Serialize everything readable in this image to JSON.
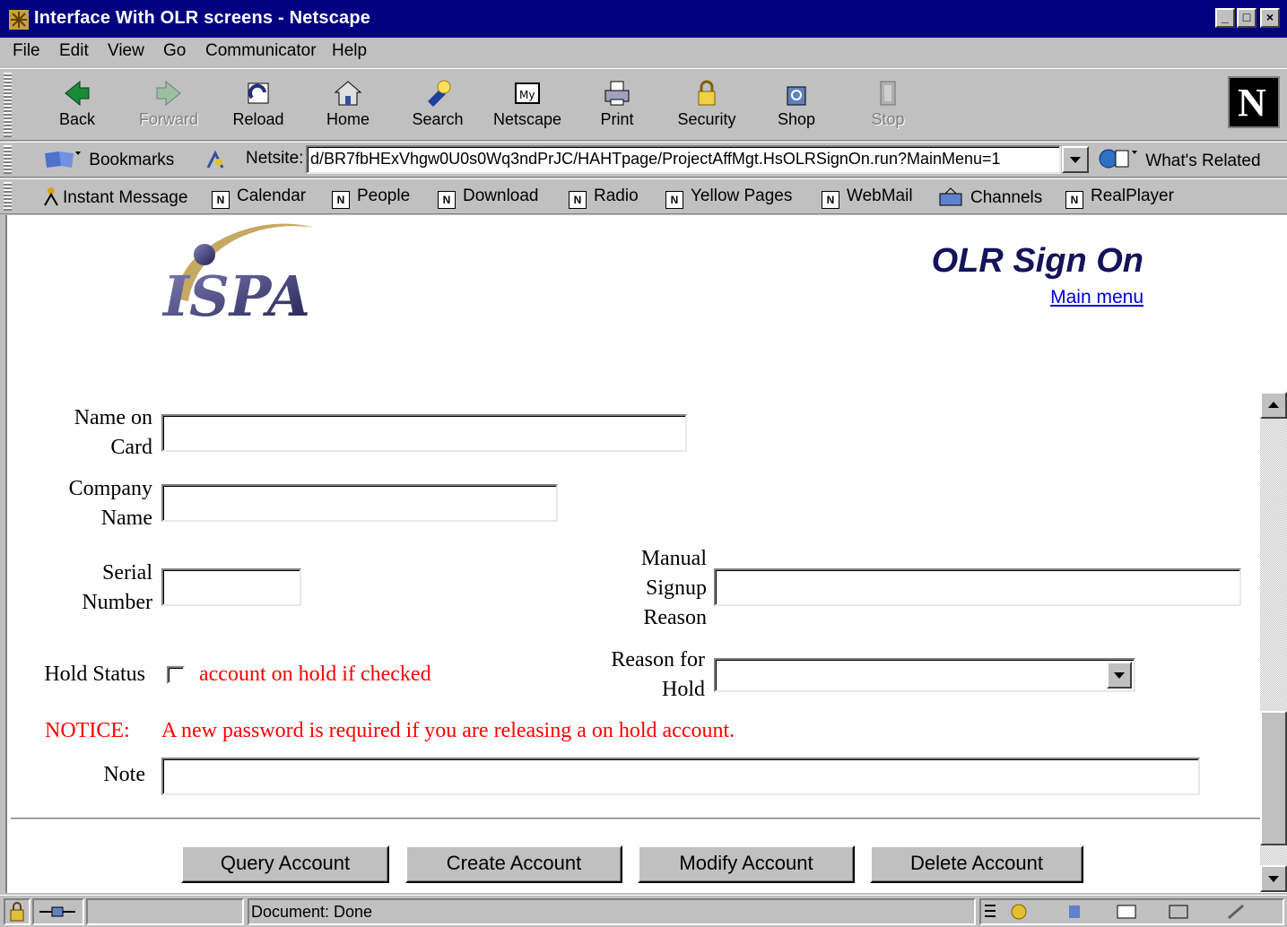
{
  "window": {
    "title": "Interface With OLR screens - Netscape",
    "minimize": "_",
    "maximize": "□",
    "close": "×"
  },
  "menu": [
    "File",
    "Edit",
    "View",
    "Go",
    "Communicator",
    "Help"
  ],
  "toolbar": {
    "back": "Back",
    "forward": "Forward",
    "reload": "Reload",
    "home": "Home",
    "search": "Search",
    "netscape": "Netscape",
    "print": "Print",
    "security": "Security",
    "shop": "Shop",
    "stop": "Stop",
    "logo": "N"
  },
  "location": {
    "bookmarks": "Bookmarks",
    "label": "Netsite:",
    "url": "d/BR7fbHExVhgw0U0s0Wq3ndPrJC/HAHTpage/ProjectAffMgt.HsOLRSignOn.run?MainMenu=1",
    "related": "What's Related"
  },
  "personal": [
    "Instant Message",
    "Calendar",
    "People",
    "Download",
    "Radio",
    "Yellow Pages",
    "WebMail",
    "Channels",
    "RealPlayer"
  ],
  "page": {
    "logo_text": "ISPA",
    "title": "OLR Sign On",
    "main_menu": "Main menu",
    "labels": {
      "name_on_card_1": "Name on",
      "name_on_card_2": "Card",
      "company_1": "Company",
      "company_2": "Name",
      "serial_1": "Serial",
      "serial_2": "Number",
      "manual_1": "Manual",
      "manual_2": "Signup",
      "manual_3": "Reason",
      "hold_status": "Hold Status",
      "hold_hint": "account on hold if checked",
      "reason_hold_1": "Reason for",
      "reason_hold_2": "Hold",
      "notice_label": "NOTICE:",
      "notice_text": "A new password is required if you are releasing a on hold account.",
      "note": "Note"
    },
    "fields": {
      "name_on_card": "",
      "company_name": "",
      "serial_number": "",
      "manual_signup_reason": "",
      "reason_for_hold": "",
      "note": "",
      "hold_checked": false
    },
    "buttons": {
      "query": "Query Account",
      "create": "Create Account",
      "modify": "Modify Account",
      "delete": "Delete Account"
    }
  },
  "status": {
    "text": "Document: Done"
  },
  "colors": {
    "title_bar": "#000080",
    "chrome": "#c0c0c0",
    "notice_red": "#ff0000",
    "link": "#0000cc",
    "heading": "#14145a"
  }
}
